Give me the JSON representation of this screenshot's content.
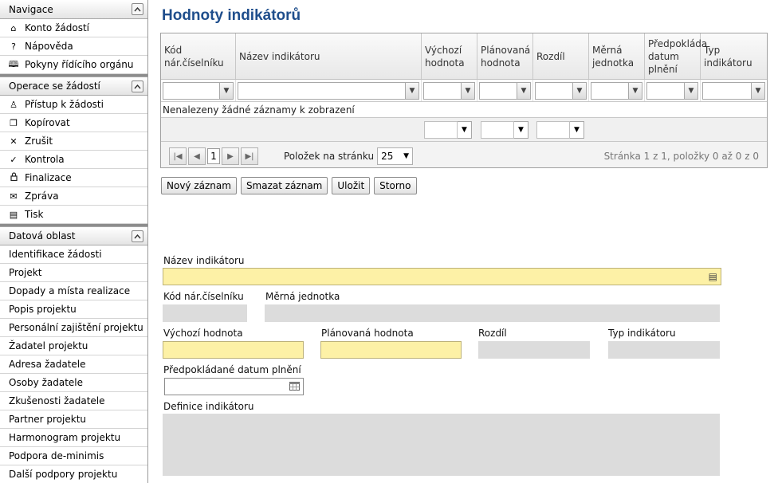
{
  "sidebar": {
    "sections": [
      {
        "title": "Navigace",
        "items": [
          {
            "icon": "home-icon",
            "glyph": "⌂",
            "label": "Konto žádostí"
          },
          {
            "icon": "help-icon",
            "glyph": "?",
            "label": "Nápověda"
          },
          {
            "icon": "book-icon",
            "glyph": "🕮",
            "label": "Pokyny řídícího orgánu"
          }
        ]
      },
      {
        "title": "Operace se žádostí",
        "items": [
          {
            "icon": "user-icon",
            "glyph": "♙",
            "label": "Přístup k žádosti"
          },
          {
            "icon": "copy-icon",
            "glyph": "❐",
            "label": "Kopírovat"
          },
          {
            "icon": "close-icon",
            "glyph": "✕",
            "label": "Zrušit"
          },
          {
            "icon": "check-icon",
            "glyph": "✓",
            "label": "Kontrola"
          },
          {
            "icon": "lock-icon",
            "glyph": "🔒",
            "label": "Finalizace"
          },
          {
            "icon": "mail-icon",
            "glyph": "✉",
            "label": "Zpráva"
          },
          {
            "icon": "print-icon",
            "glyph": "▤",
            "label": "Tisk"
          }
        ]
      },
      {
        "title": "Datová oblast",
        "items": [
          {
            "label": "Identifikace žádosti"
          },
          {
            "label": "Projekt"
          },
          {
            "label": "Dopady a místa realizace"
          },
          {
            "label": "Popis projektu"
          },
          {
            "label": "Personální zajištění projektu"
          },
          {
            "label": "Žadatel projektu"
          },
          {
            "label": "Adresa žadatele"
          },
          {
            "label": "Osoby žadatele"
          },
          {
            "label": "Zkušenosti žadatele"
          },
          {
            "label": "Partner projektu"
          },
          {
            "label": "Harmonogram projektu"
          },
          {
            "label": "Podpora de-minimis"
          },
          {
            "label": "Další podpory projektu"
          }
        ]
      }
    ]
  },
  "page_title": "Hodnoty indikátorů",
  "grid": {
    "columns": [
      {
        "label": "Kód nár.číselníku"
      },
      {
        "label": "Název indikátoru"
      },
      {
        "label": "Výchozí hodnota"
      },
      {
        "label": "Plánovaná hodnota"
      },
      {
        "label": "Rozdíl"
      },
      {
        "label": "Měrná jednotka"
      },
      {
        "label": "Předpokláda datum plnění"
      },
      {
        "label": "Typ indikátoru"
      }
    ],
    "empty_message": "Nenalezeny žádné záznamy k zobrazení",
    "pager": {
      "current_page": "1",
      "page_size_label": "Položek na stránku",
      "page_size": "25",
      "info": "Stránka 1 z 1, položky 0 až 0 z 0"
    }
  },
  "actions": {
    "new": "Nový záznam",
    "delete": "Smazat záznam",
    "save": "Uložit",
    "cancel": "Storno"
  },
  "form": {
    "indicator_name_label": "Název indikátoru",
    "code_label": "Kód nár.číselníku",
    "unit_label": "Měrná jednotka",
    "initial_value_label": "Výchozí hodnota",
    "planned_value_label": "Plánovaná hodnota",
    "difference_label": "Rozdíl",
    "indicator_type_label": "Typ indikátoru",
    "expected_date_label": "Předpokládané datum plnění",
    "definition_label": "Definice indikátoru"
  },
  "colors": {
    "title": "#1f4e8c",
    "required_field": "#fdf1a6",
    "readonly_field": "#dcdcdc"
  }
}
